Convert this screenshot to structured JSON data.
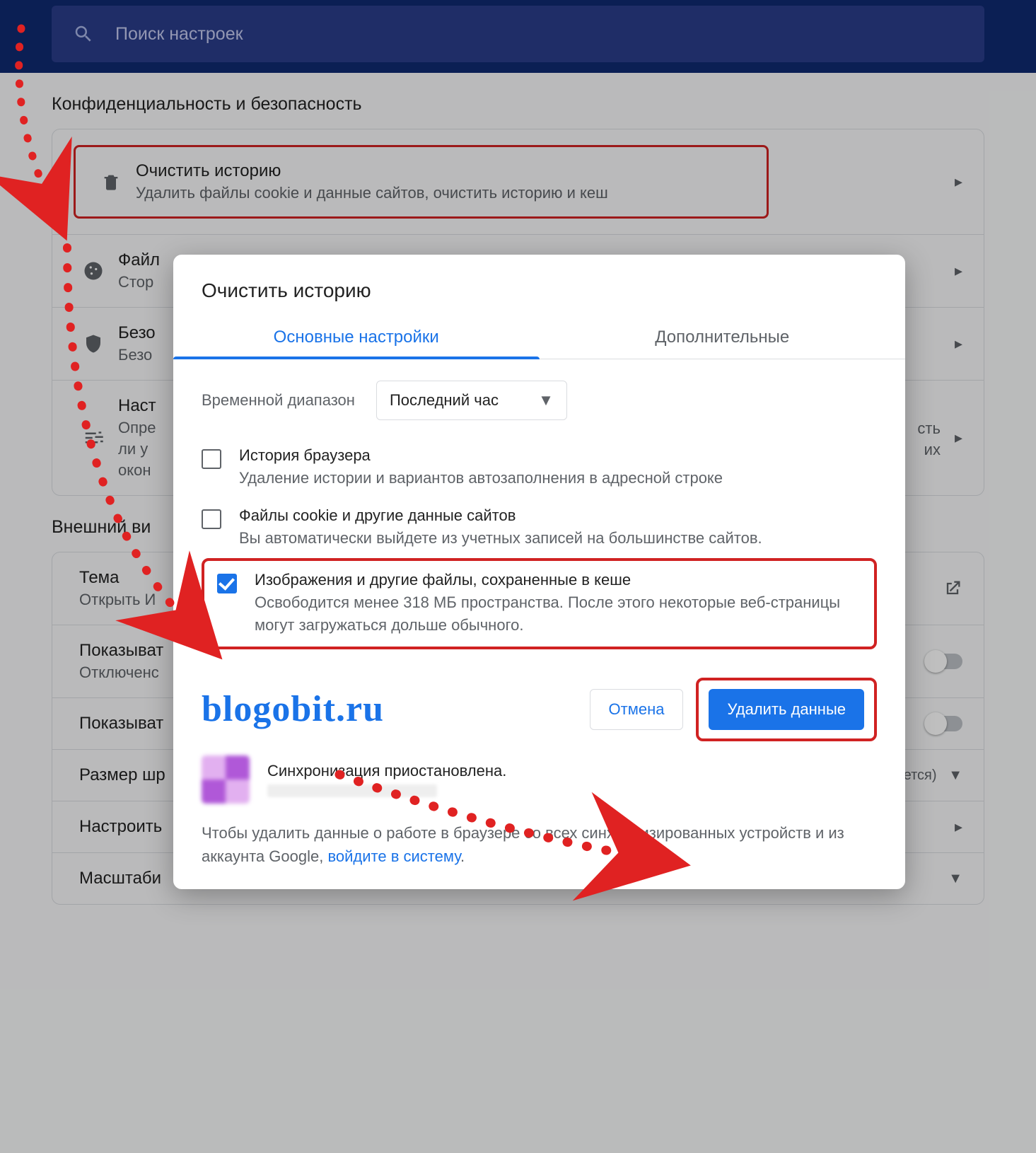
{
  "search": {
    "placeholder": "Поиск настроек"
  },
  "privacy": {
    "section_title": "Конфиденциальность и безопасность",
    "clear": {
      "title": "Очистить историю",
      "sub": "Удалить файлы cookie и данные сайтов, очистить историю и кеш"
    },
    "cookies": {
      "title": "Файл",
      "sub": "Стор"
    },
    "security": {
      "title": "Безо",
      "sub": "Безо"
    },
    "site": {
      "title": "Наст",
      "sub1": "Опре",
      "sub2": "ли у",
      "sub3": "окон",
      "sub_r1": "сть",
      "sub_r2": "их"
    }
  },
  "appearance": {
    "section_title": "Внешний ви",
    "theme": {
      "title": "Тема",
      "sub": "Открыть И"
    },
    "show1": {
      "title": "Показыват",
      "sub": "Отключенc"
    },
    "show2": {
      "title": "Показыват"
    },
    "font": {
      "title": "Размер шр",
      "value": "ется)"
    },
    "custom": {
      "title": "Настроить"
    },
    "zoom": {
      "title": "Масштаби"
    }
  },
  "dialog": {
    "title": "Очистить историю",
    "tab_basic": "Основные настройки",
    "tab_advanced": "Дополнительные",
    "range_label": "Временной диапазон",
    "range_value": "Последний час",
    "history": {
      "title": "История браузера",
      "sub": "Удаление истории и вариантов автозаполнения в адресной строке"
    },
    "cookies": {
      "title": "Файлы cookie и другие данные сайтов",
      "sub": "Вы автоматически выйдете из учетных записей на большинстве сайтов."
    },
    "cache": {
      "title": "Изображения и другие файлы, сохраненные в кеше",
      "sub": "Освободится менее 318 МБ пространства. После этого некоторые веб-страницы могут загружаться дольше обычного."
    },
    "cancel": "Отмена",
    "clear": "Удалить данные",
    "sync_title": "Синхронизация приостановлена.",
    "note_pre": "Чтобы удалить данные о работе в браузере со всех синхронизированных устройств и из аккаунта Google, ",
    "note_link": "войдите в систему",
    "note_post": "."
  },
  "watermark": "blogobit.ru"
}
